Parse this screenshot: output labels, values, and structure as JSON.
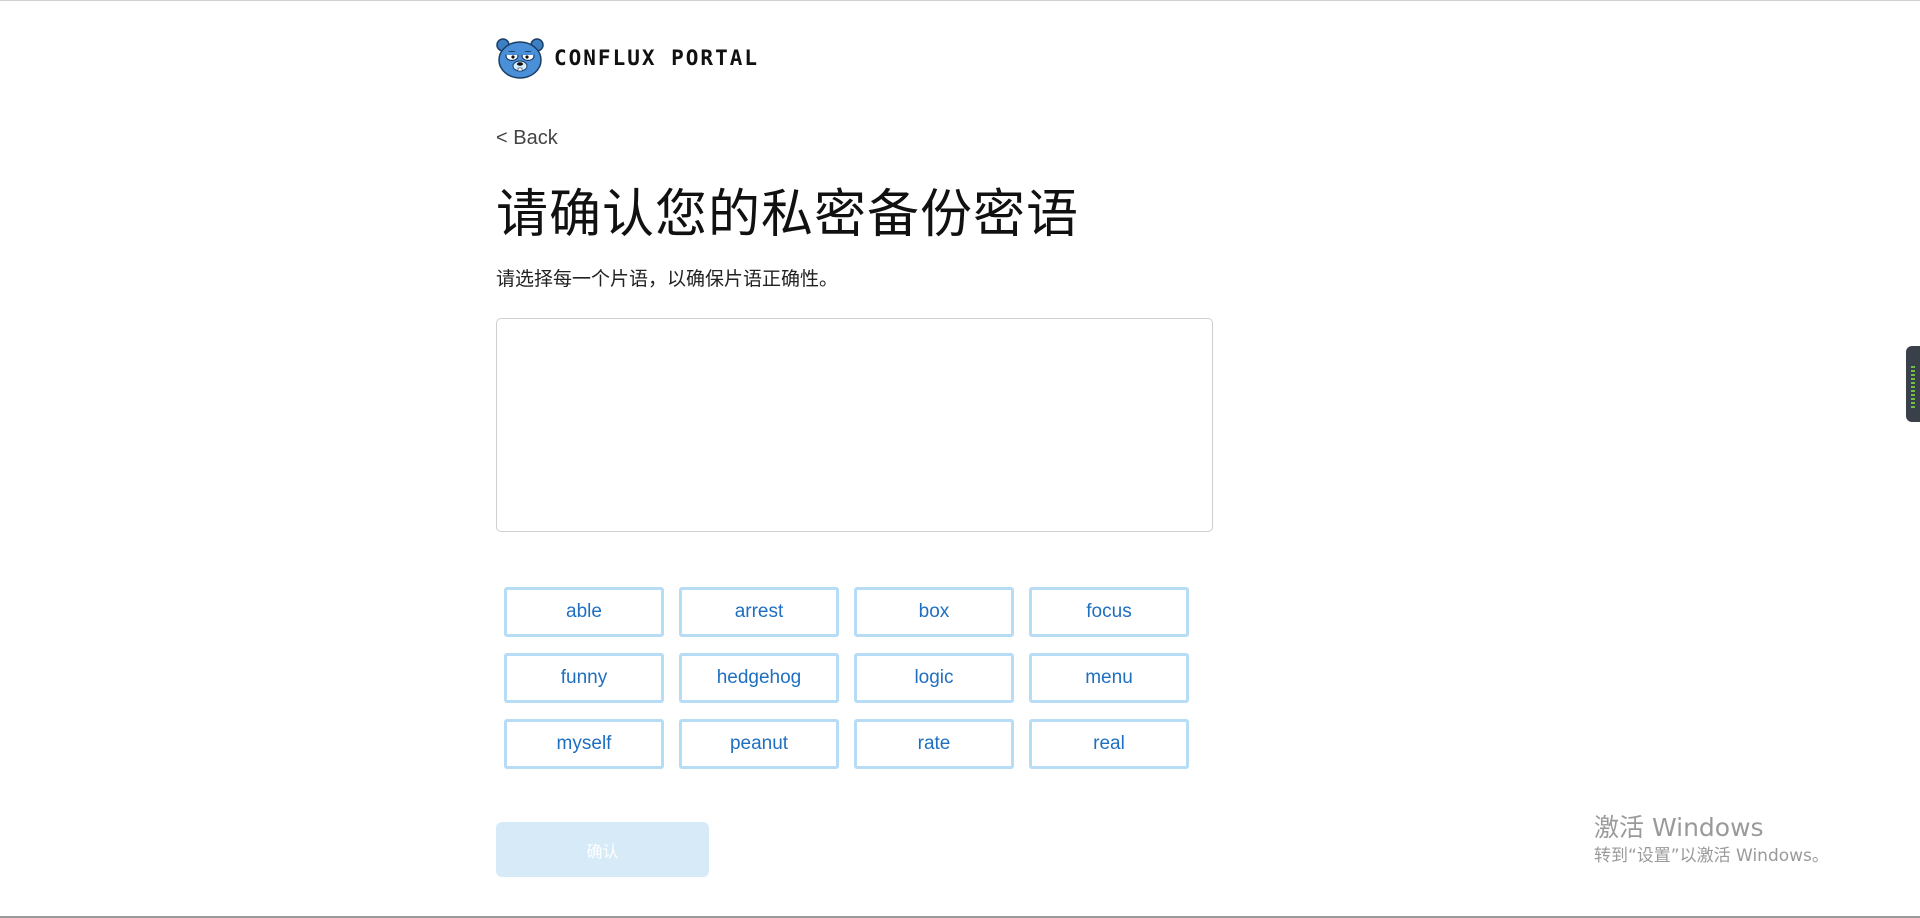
{
  "header": {
    "logo_mascot": "panda-mascot-icon",
    "logo_text": "CONFLUX PORTAL"
  },
  "nav": {
    "back_label": "< Back"
  },
  "main": {
    "title": "请确认您的私密备份密语",
    "subtitle": "请选择每一个片语，以确保片语正确性。",
    "phrase_box_value": "",
    "words": [
      "able",
      "arrest",
      "box",
      "focus",
      "funny",
      "hedgehog",
      "logic",
      "menu",
      "myself",
      "peanut",
      "rate",
      "real"
    ],
    "confirm_label": "确认"
  },
  "watermark": {
    "line1": "激活 Windows",
    "line2": "转到“设置”以激活 Windows。"
  },
  "colors": {
    "accent": "#1f6fc0",
    "word_border": "#b7dcf6",
    "confirm_disabled_bg": "#d6eaf8"
  }
}
